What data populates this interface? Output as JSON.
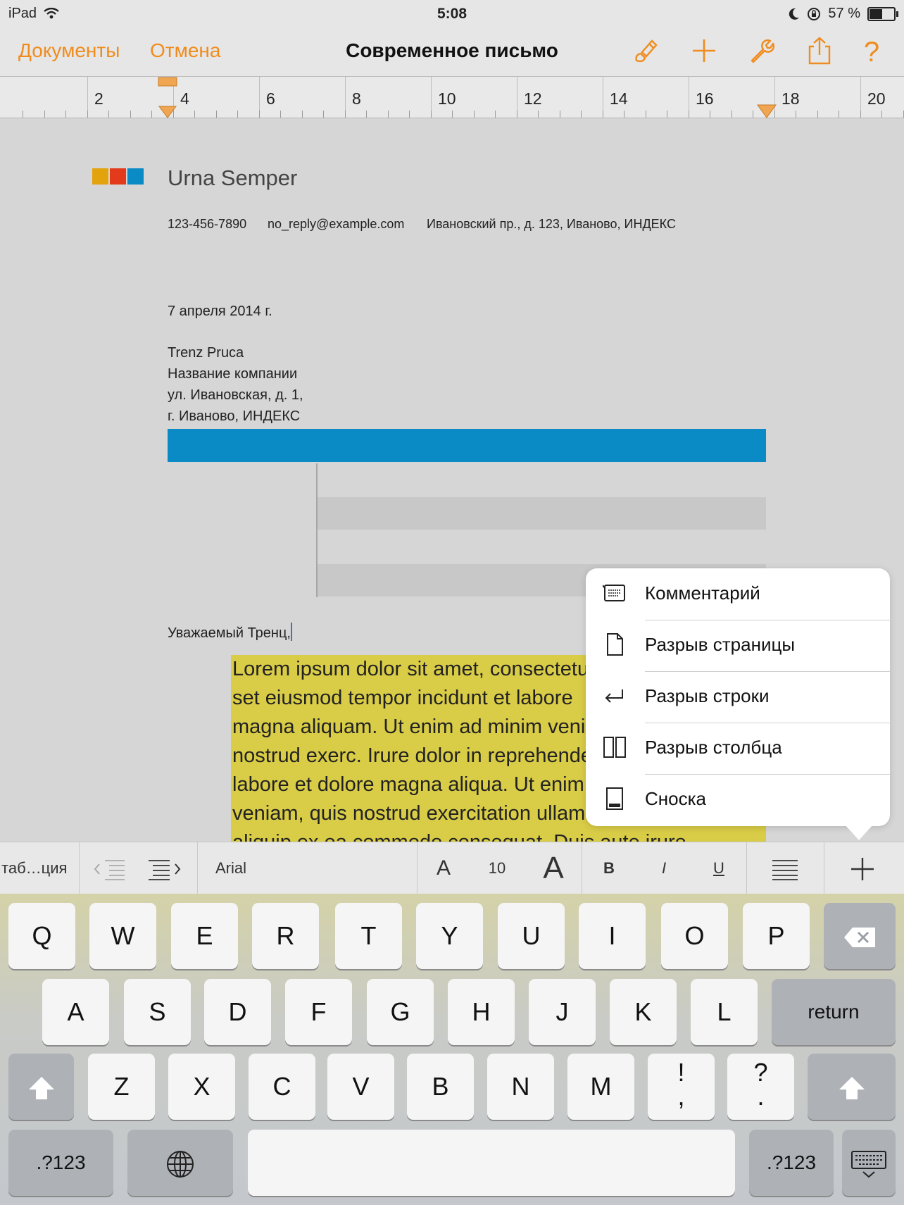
{
  "status_bar": {
    "device": "iPad",
    "time": "5:08",
    "battery_text": "57 %",
    "battery_level": 0.57
  },
  "nav": {
    "documents_label": "Документы",
    "cancel_label": "Отмена",
    "title": "Современное письмо",
    "icons": [
      "paintbrush-icon",
      "plus-icon",
      "wrench-icon",
      "share-icon",
      "help-icon"
    ],
    "help_glyph": "?"
  },
  "ruler": {
    "labels": [
      "2",
      "4",
      "6",
      "8",
      "10",
      "12",
      "14",
      "16",
      "18",
      "20"
    ]
  },
  "document": {
    "sender_name": "Urna Semper",
    "phone": "123-456-7890",
    "email": "no_reply@example.com",
    "address": "Ивановский пр., д. 123,  Иваново, ИНДЕКС",
    "date": "7 апреля 2014 г.",
    "recipient": [
      "Trenz Pruca",
      "Название компании",
      "ул. Ивановская, д. 1,",
      "г. Иваново, ИНДЕКС"
    ],
    "greeting": "Уважаемый Тренц,",
    "body_lines": [
      "Lorem ipsum dolor sit amet, consectetur",
      "set eiusmod tempor incidunt et labore",
      "magna aliquam. Ut enim ad minim veniam",
      "nostrud exerc. Irure dolor in reprehenderit",
      "labore et dolore magna aliqua. Ut enim",
      "veniam, quis nostrud exercitation ullamco",
      "aliquip ex ea commodo consequat. Duis aute irure"
    ],
    "logo_colors": [
      "#e2a30c",
      "#e33a1b",
      "#0a8bc5"
    ],
    "accent_color": "#0a8bc5",
    "highlight_color": "#d9cc47"
  },
  "popup_menu": {
    "items": [
      {
        "label": "Комментарий",
        "icon": "comment-icon"
      },
      {
        "label": "Разрыв страницы",
        "icon": "page-break-icon"
      },
      {
        "label": "Разрыв строки",
        "icon": "line-break-icon"
      },
      {
        "label": "Разрыв столбца",
        "icon": "column-break-icon"
      },
      {
        "label": "Сноска",
        "icon": "footnote-icon"
      }
    ]
  },
  "format_bar": {
    "style_label": "таб…ция",
    "font_name": "Arial",
    "font_small_a": "A",
    "font_size": "10",
    "font_large_a": "A",
    "bold": "B",
    "italic": "I",
    "underline": "U",
    "accent_color": "#f08c1e"
  },
  "keyboard": {
    "row1": [
      "Q",
      "W",
      "E",
      "R",
      "T",
      "Y",
      "U",
      "I",
      "O",
      "P"
    ],
    "row2": [
      "A",
      "S",
      "D",
      "F",
      "G",
      "H",
      "J",
      "K",
      "L"
    ],
    "return_label": "return",
    "row3": [
      "Z",
      "X",
      "C",
      "V",
      "B",
      "N",
      "M"
    ],
    "excl_top": "!",
    "excl_bottom": ",",
    "quest_top": "?",
    "quest_bottom": ".",
    "numbers_label": ".?123"
  }
}
